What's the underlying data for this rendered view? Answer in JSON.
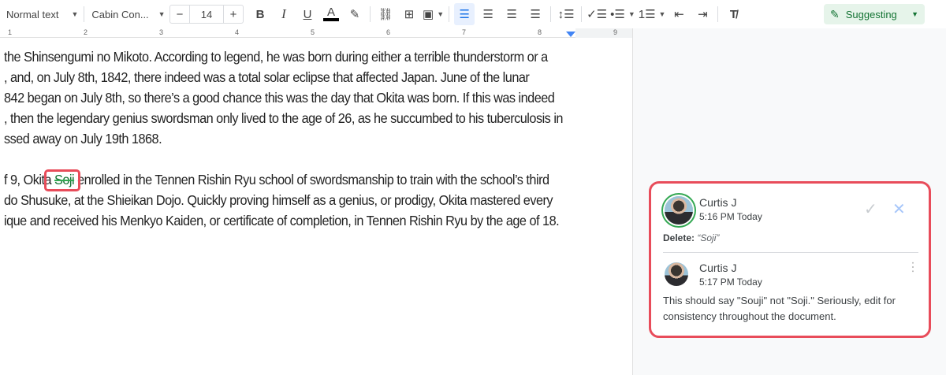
{
  "toolbar": {
    "style": "Normal text",
    "font": "Cabin Con...",
    "font_size": "14",
    "minus": "−",
    "plus": "+",
    "mode": "Suggesting",
    "text_color": "#000000"
  },
  "ruler": {
    "marks": [
      "1",
      "2",
      "3",
      "4",
      "5",
      "6",
      "7",
      "8",
      "9"
    ]
  },
  "document": {
    "lines": [
      "the Shinsengumi no Mikoto. According to legend, he was born during either a terrible thunderstorm or a",
      ", and, on July 8th, 1842, there indeed was a total solar eclipse that affected Japan. June of the lunar",
      "842 began on July 8th, so there’s a good chance this was the day that Okita was born. If this was indeed",
      ", then the legendary genius swordsman only lived to the age of 26, as he succumbed to his tuberculosis in",
      "ssed away on July 19th 1868."
    ],
    "para2_prefix": "f 9, Okita ",
    "deleted_word": "Soji",
    "para2_suffix": " enrolled in the Tennen Rishin Ryu school of swordsmanship to train with the school’s third",
    "para2_lines": [
      "do Shusuke, at the Shieikan Dojo. Quickly proving himself as a genius, or prodigy, Okita mastered every",
      "ique and received his Menkyo Kaiden, or certificate of completion, in Tennen Rishin Ryu by the age of 18."
    ]
  },
  "comments": {
    "suggestion": {
      "author": "Curtis J",
      "time": "5:16 PM Today",
      "label": "Delete:",
      "value": "“Soji”"
    },
    "reply": {
      "author": "Curtis J",
      "time": "5:17 PM Today",
      "text": "This should say \"Souji\" not \"Soji.\" Seriously, edit for consistency throughout the document."
    }
  },
  "colors": {
    "highlight": "#e84c5a",
    "suggest": "#137333",
    "accent": "#1a73e8"
  }
}
